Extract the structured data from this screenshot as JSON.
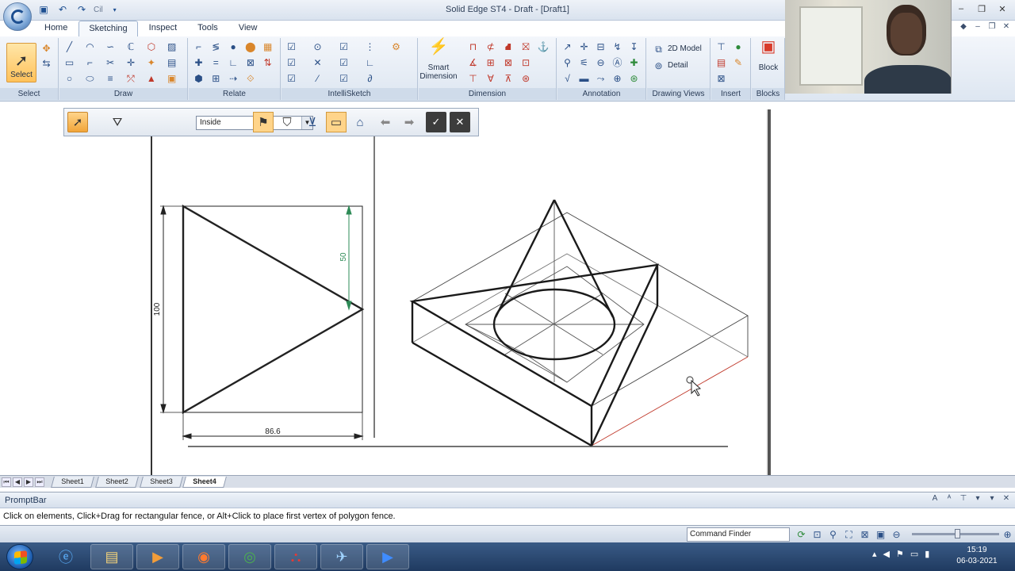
{
  "window": {
    "title": "Solid Edge ST4 - Draft - [Draft1]"
  },
  "qat": {
    "undo_label": "Cil"
  },
  "ribbon": {
    "tabs": [
      {
        "label": "Home"
      },
      {
        "label": "Sketching",
        "active": true
      },
      {
        "label": "Inspect"
      },
      {
        "label": "Tools"
      },
      {
        "label": "View"
      }
    ],
    "groups": {
      "select": "Select",
      "draw": "Draw",
      "relate": "Relate",
      "intellisketch": "IntelliSketch",
      "dimension": "Dimension",
      "annotation": "Annotation",
      "drawing_views": "Drawing Views",
      "insert": "Insert",
      "blocks": "Blocks"
    },
    "buttons": {
      "select": "Select",
      "smart_dimension": "Smart Dimension",
      "model_2d": "2D Model",
      "detail": "Detail",
      "block": "Block"
    }
  },
  "selection_toolbar": {
    "fence_mode": "Inside"
  },
  "drawing": {
    "dims": {
      "height": "100",
      "half_height": "50",
      "width": "86.6"
    }
  },
  "sheets": {
    "tabs": [
      {
        "label": "Sheet1"
      },
      {
        "label": "Sheet2"
      },
      {
        "label": "Sheet3"
      },
      {
        "label": "Sheet4",
        "active": true
      }
    ]
  },
  "promptbar": {
    "title": "PromptBar",
    "text": "Click on elements, Click+Drag for rectangular fence, or Alt+Click to place first vertex of polygon fence."
  },
  "statusbar": {
    "command_finder": "Command Finder"
  },
  "taskbar": {
    "time": "15:19",
    "date": "06-03-2021"
  },
  "colors": {
    "accent_orange": "#f1a53a",
    "ribbon_blue": "#dde6f1",
    "taskbar_blue": "#1f3a60",
    "dimension_green": "#2e8b57",
    "construction_red": "#c0392b"
  }
}
